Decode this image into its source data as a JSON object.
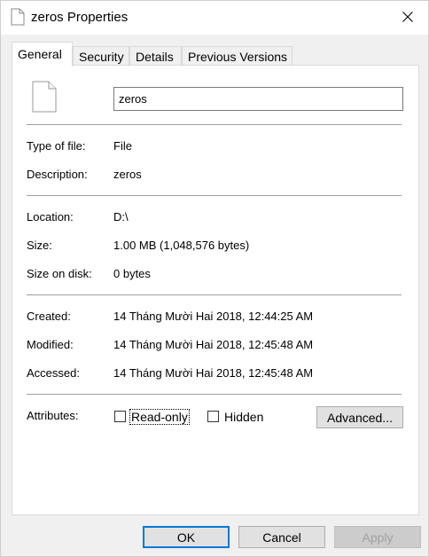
{
  "window": {
    "title": "zeros Properties",
    "icon": "document-icon",
    "close_glyph": "✕"
  },
  "tabs": [
    {
      "label": "General",
      "active": true
    },
    {
      "label": "Security",
      "active": false
    },
    {
      "label": "Details",
      "active": false
    },
    {
      "label": "Previous Versions",
      "active": false
    }
  ],
  "general": {
    "file_name": "zeros",
    "type_of_file": {
      "label": "Type of file:",
      "value": "File"
    },
    "description": {
      "label": "Description:",
      "value": "zeros"
    },
    "location": {
      "label": "Location:",
      "value": "D:\\"
    },
    "size": {
      "label": "Size:",
      "value": "1.00 MB (1,048,576 bytes)"
    },
    "size_on_disk": {
      "label": "Size on disk:",
      "value": "0 bytes"
    },
    "created": {
      "label": "Created:",
      "value": "14 Tháng Mười Hai 2018, 12:44:25 AM"
    },
    "modified": {
      "label": "Modified:",
      "value": "14 Tháng Mười Hai 2018, 12:45:48 AM"
    },
    "accessed": {
      "label": "Accessed:",
      "value": "14 Tháng Mười Hai 2018, 12:45:48 AM"
    },
    "attributes": {
      "label": "Attributes:",
      "read_only": {
        "label": "Read-only",
        "checked": false
      },
      "hidden": {
        "label": "Hidden",
        "checked": false
      },
      "advanced_label": "Advanced..."
    }
  },
  "buttons": {
    "ok": "OK",
    "cancel": "Cancel",
    "apply": "Apply"
  },
  "colors": {
    "accent": "#0078d7",
    "panel_bg": "#ffffff",
    "window_bg": "#f0f0f0"
  }
}
